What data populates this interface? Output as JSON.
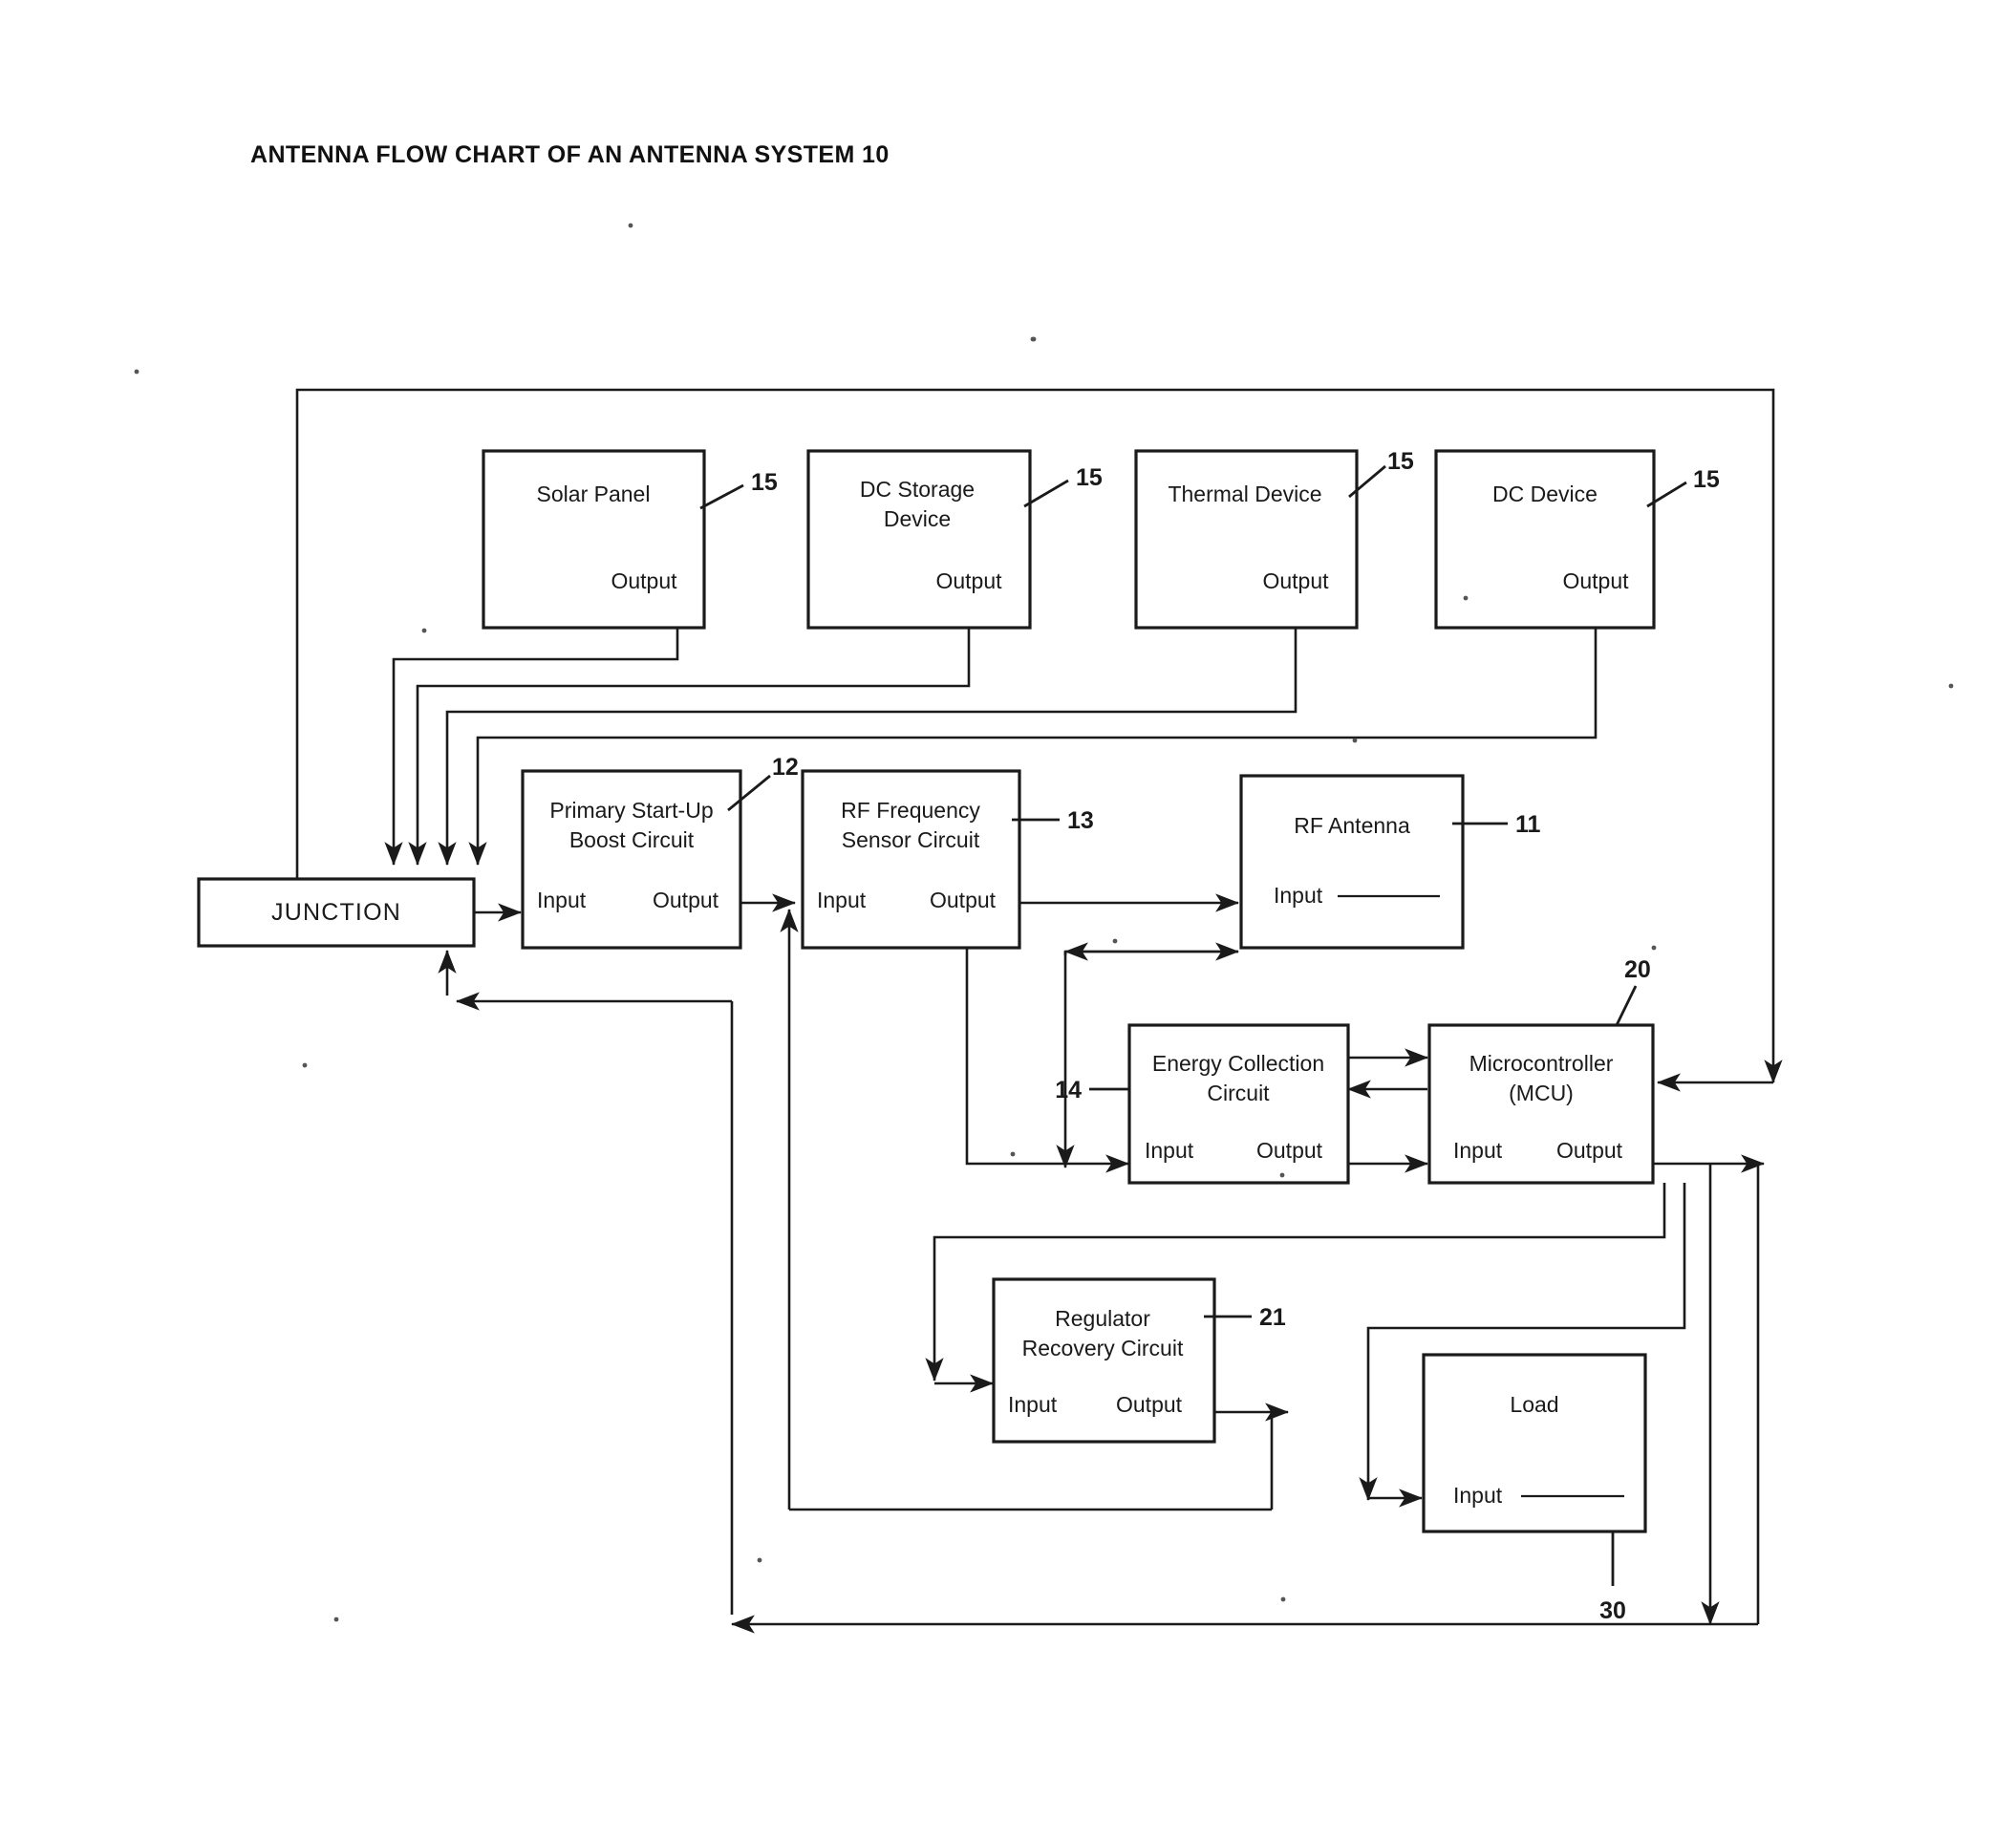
{
  "page": {
    "title": "ANTENNA FLOW CHART OF AN ANTENNA SYSTEM 10",
    "background_color": "#ffffff",
    "ink_color": "#1a1a1a"
  },
  "labels": {
    "input": "Input",
    "output": "Output"
  },
  "blocks": [
    {
      "id": "solar-panel",
      "name": "Solar Panel",
      "line1": "Solar Panel",
      "line2": "",
      "ref": "15",
      "ports": [
        "Output"
      ]
    },
    {
      "id": "dc-storage-device",
      "name": "DC Storage Device",
      "line1": "DC Storage",
      "line2": "Device",
      "ref": "15",
      "ports": [
        "Output"
      ]
    },
    {
      "id": "thermal-device",
      "name": "Thermal Device",
      "line1": "Thermal Device",
      "line2": "",
      "ref": "15",
      "ports": [
        "Output"
      ]
    },
    {
      "id": "dc-device",
      "name": "DC Device",
      "line1": "DC Device",
      "line2": "",
      "ref": "15",
      "ports": [
        "Output"
      ]
    },
    {
      "id": "junction",
      "name": "JUNCTION",
      "line1": "JUNCTION",
      "line2": "",
      "ref": "",
      "ports": []
    },
    {
      "id": "primary-start-up-boost-circuit",
      "name": "Primary Start-Up Boost Circuit",
      "line1": "Primary Start-Up",
      "line2": "Boost Circuit",
      "ref": "12",
      "ports": [
        "Input",
        "Output"
      ]
    },
    {
      "id": "rf-frequency-sensor-circuit",
      "name": "RF Frequency Sensor Circuit",
      "line1": "RF Frequency",
      "line2": "Sensor Circuit",
      "ref": "13",
      "ports": [
        "Input",
        "Output"
      ]
    },
    {
      "id": "rf-antenna",
      "name": "RF Antenna",
      "line1": "RF Antenna",
      "line2": "",
      "ref": "11",
      "ports": [
        "Input"
      ]
    },
    {
      "id": "energy-collection-circuit",
      "name": "Energy Collection Circuit",
      "line1": "Energy Collection",
      "line2": "Circuit",
      "ref": "14",
      "ports": [
        "Input",
        "Output"
      ]
    },
    {
      "id": "microcontroller",
      "name": "Microcontroller (MCU)",
      "line1": "Microcontroller",
      "line2": "(MCU)",
      "ref": "20",
      "ports": [
        "Input",
        "Output"
      ]
    },
    {
      "id": "regulator-recovery-circuit",
      "name": "Regulator Recovery Circuit",
      "line1": "Regulator",
      "line2": "Recovery Circuit",
      "ref": "21",
      "ports": [
        "Input",
        "Output"
      ]
    },
    {
      "id": "load",
      "name": "Load",
      "line1": "Load",
      "line2": "",
      "ref": "30",
      "ports": [
        "Input"
      ]
    }
  ],
  "reference_numerals": {
    "system": "10",
    "rf_antenna": "11",
    "primary_boost": "12",
    "rf_sensor": "13",
    "energy_collection": "14",
    "sources": "15",
    "mcu": "20",
    "regulator": "21",
    "load": "30"
  }
}
